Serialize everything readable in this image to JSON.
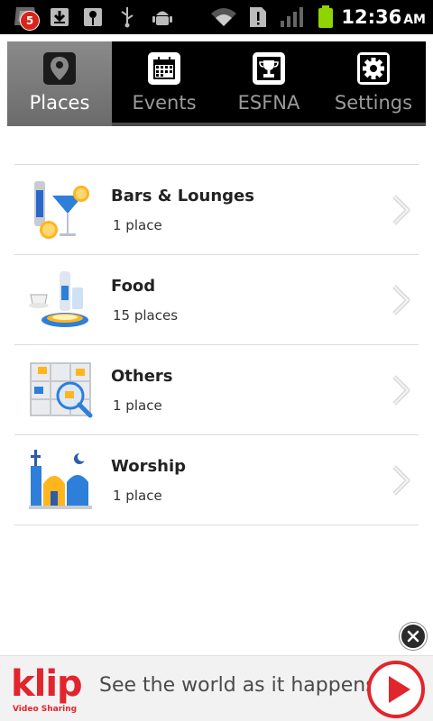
{
  "status_bar": {
    "notification_count": "5",
    "time": "12:36",
    "ampm": "AM"
  },
  "tabs": [
    {
      "label": "Places",
      "icon": "map-pin-icon",
      "active": true
    },
    {
      "label": "Events",
      "icon": "calendar-icon",
      "active": false
    },
    {
      "label": "ESFNA",
      "icon": "trophy-icon",
      "active": false
    },
    {
      "label": "Settings",
      "icon": "gear-icon",
      "active": false
    }
  ],
  "categories": [
    {
      "title": "Bars & Lounges",
      "subtitle": "1 place",
      "icon": "cocktail-icon"
    },
    {
      "title": "Food",
      "subtitle": "15 places",
      "icon": "food-plate-icon"
    },
    {
      "title": "Others",
      "subtitle": "1 place",
      "icon": "map-search-icon"
    },
    {
      "title": "Worship",
      "subtitle": "1 place",
      "icon": "worship-icon"
    }
  ],
  "ad": {
    "brand": "klip",
    "brand_sub": "Video Sharing",
    "tagline": "See the world as it happens",
    "brand_color": "#e1252d"
  }
}
